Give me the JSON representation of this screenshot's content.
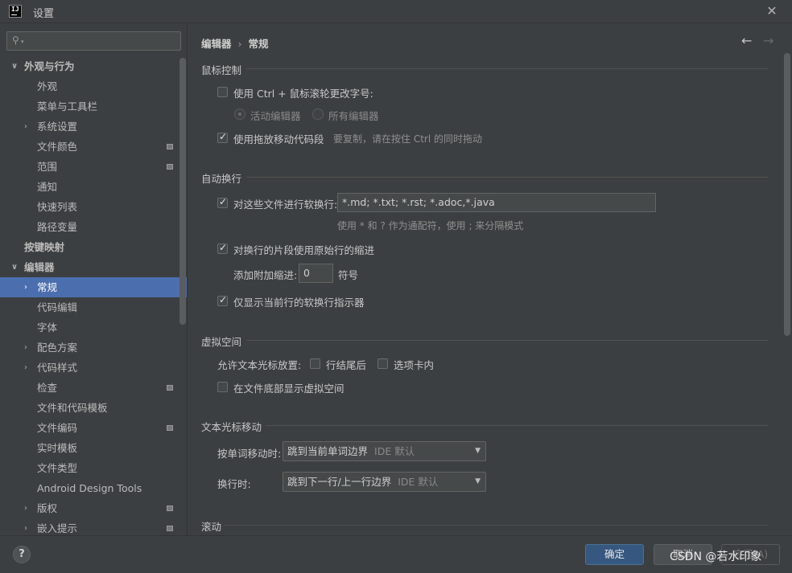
{
  "window": {
    "title": "设置",
    "icon": "intellij-logo-icon",
    "close": "✕"
  },
  "sidebar": {
    "search_placeholder": "",
    "items": [
      {
        "label": "外观与行为",
        "level": 0,
        "bold": true,
        "arrow": "∨"
      },
      {
        "label": "外观",
        "level": 1
      },
      {
        "label": "菜单与工具栏",
        "level": 1
      },
      {
        "label": "系统设置",
        "level": 1,
        "arrow": "›"
      },
      {
        "label": "文件颜色",
        "level": 1,
        "badge": true
      },
      {
        "label": "范围",
        "level": 1,
        "badge": true
      },
      {
        "label": "通知",
        "level": 1
      },
      {
        "label": "快速列表",
        "level": 1
      },
      {
        "label": "路径变量",
        "level": 1
      },
      {
        "label": "按键映射",
        "level": 0,
        "bold": true
      },
      {
        "label": "编辑器",
        "level": 0,
        "bold": true,
        "arrow": "∨"
      },
      {
        "label": "常规",
        "level": 1,
        "arrow": "›",
        "selected": true
      },
      {
        "label": "代码编辑",
        "level": 1
      },
      {
        "label": "字体",
        "level": 1
      },
      {
        "label": "配色方案",
        "level": 1,
        "arrow": "›"
      },
      {
        "label": "代码样式",
        "level": 1,
        "arrow": "›"
      },
      {
        "label": "检查",
        "level": 1,
        "badge": true
      },
      {
        "label": "文件和代码模板",
        "level": 1
      },
      {
        "label": "文件编码",
        "level": 1,
        "badge": true
      },
      {
        "label": "实时模板",
        "level": 1
      },
      {
        "label": "文件类型",
        "level": 1
      },
      {
        "label": "Android Design Tools",
        "level": 1
      },
      {
        "label": "版权",
        "level": 1,
        "arrow": "›",
        "badge": true
      },
      {
        "label": "嵌入提示",
        "level": 1,
        "arrow": "›",
        "badge": true
      }
    ]
  },
  "breadcrumb": {
    "parent": "编辑器",
    "separator": "›",
    "current": "常规",
    "back": "←",
    "forward": "→"
  },
  "mouse_control": {
    "title": "鼠标控制",
    "ctrl_wheel": {
      "label": "使用 Ctrl + 鼠标滚轮更改字号:",
      "checked": false
    },
    "radio_active": "活动编辑器",
    "radio_all": "所有编辑器",
    "drag_move": {
      "label": "使用拖放移动代码段",
      "checked": true
    },
    "drag_hint": "要复制，请在按住 Ctrl 的同时拖动"
  },
  "soft_wrap": {
    "title": "自动换行",
    "wrap_files": {
      "label": "对这些文件进行软换行:",
      "checked": true
    },
    "patterns": "*.md; *.txt; *.rst; *.adoc,*.java",
    "patterns_hint": "使用 * 和 ? 作为通配符，使用 ; 来分隔模式",
    "indent": {
      "label": "对换行的片段使用原始行的缩进",
      "checked": true
    },
    "extra_indent_label": "添加附加缩进:",
    "extra_indent_value": "0",
    "extra_indent_unit": "符号",
    "current_only": {
      "label": "仅显示当前行的软换行指示器",
      "checked": true
    }
  },
  "virtual_space": {
    "title": "虚拟空间",
    "allow_label": "允许文本光标放置:",
    "after_eol": {
      "label": "行结尾后",
      "checked": false
    },
    "inside_tabs": {
      "label": "选项卡内",
      "checked": false
    },
    "at_bottom": {
      "label": "在文件底部显示虚拟空间",
      "checked": false
    }
  },
  "caret_movement": {
    "title": "文本光标移动",
    "word_label": "按单词移动时:",
    "word_value": "跳到当前单词边界",
    "word_default": "IDE 默认",
    "line_label": "换行时:",
    "line_value": "跳到下一行/上一行边界",
    "line_default": "IDE 默认"
  },
  "scrolling": {
    "title": "滚动"
  },
  "footer": {
    "help": "?",
    "ok": "确定",
    "cancel": "取消",
    "apply": "应用(A)",
    "watermark": "CSDN @若水印象"
  }
}
